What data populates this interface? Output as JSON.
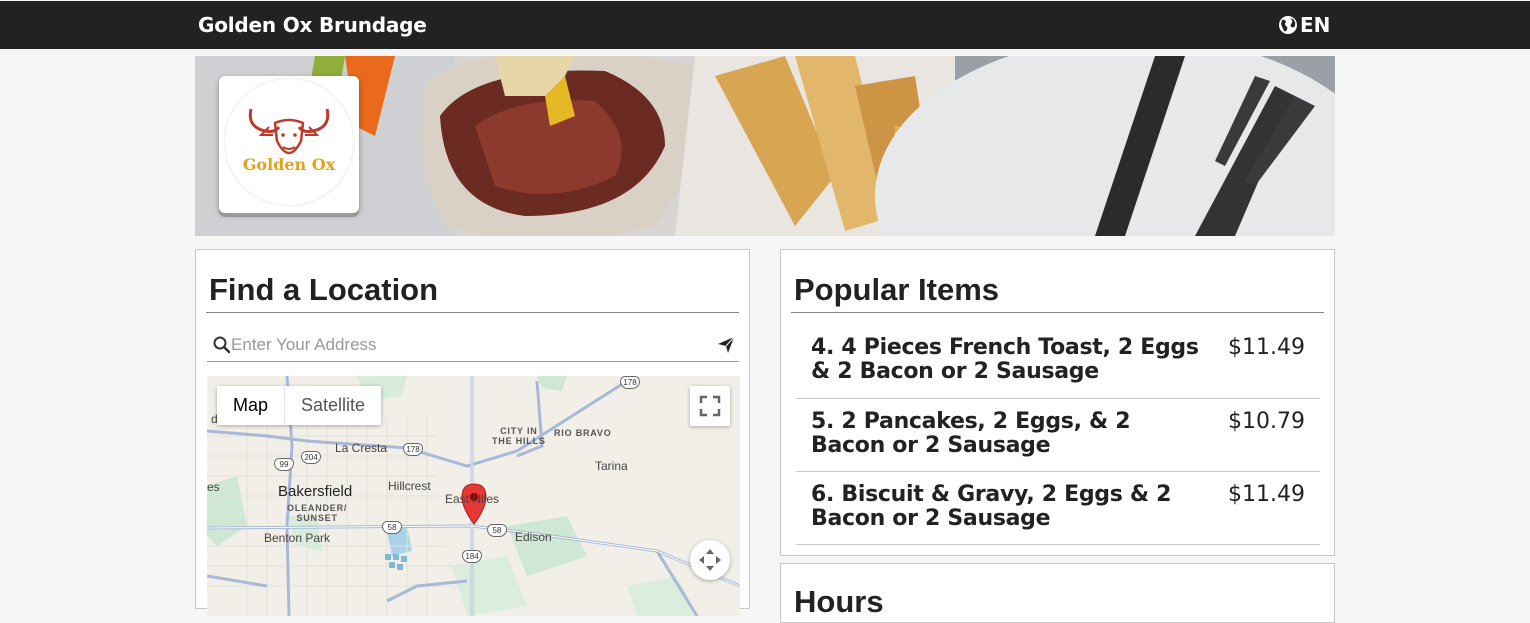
{
  "header": {
    "brand": "Golden Ox Brundage",
    "language": "EN"
  },
  "logo": {
    "text": "Golden Ox"
  },
  "find_location": {
    "title": "Find a Location",
    "search_placeholder": "Enter Your Address",
    "map_tab_map": "Map",
    "map_tab_satellite": "Satellite",
    "map_labels": {
      "city_in_the_hills": "CITY IN\nTHE HILLS",
      "rio_bravo": "RIO BRAVO",
      "la_cresta": "La Cresta",
      "tarina": "Tarina",
      "bakersfield": "Bakersfield",
      "hillcrest": "Hillcrest",
      "east_niles": "East Niles",
      "oleander_sunset": "OLEANDER/\nSUNSET",
      "benton_park": "Benton Park",
      "edison": "Edison",
      "es": "es",
      "d": "d"
    },
    "shields": [
      "178",
      "204",
      "99",
      "178",
      "58",
      "58",
      "184"
    ]
  },
  "popular": {
    "title": "Popular Items",
    "items": [
      {
        "name": "4. 4 Pieces French Toast, 2 Eggs & 2 Bacon or 2 Sausage",
        "price": "$11.49"
      },
      {
        "name": "5. 2 Pancakes, 2 Eggs, & 2 Bacon or 2 Sausage",
        "price": "$10.79"
      },
      {
        "name": "6. Biscuit & Gravy, 2 Eggs & 2 Bacon or 2 Sausage",
        "price": "$11.49"
      }
    ]
  },
  "hours": {
    "title": "Hours"
  },
  "colors": {
    "topbar": "#222222",
    "marker": "#e53935",
    "logo_gold": "#e5a11a",
    "logo_red": "#c0392b"
  }
}
